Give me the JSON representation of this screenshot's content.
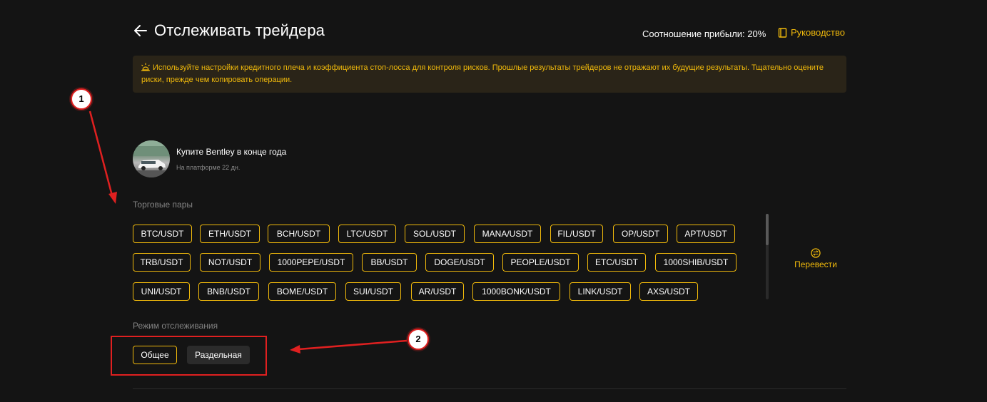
{
  "header": {
    "title": "Отслеживать трейдера",
    "profit_ratio": "Соотношение прибыли: 20%",
    "guide_label": "Руководство"
  },
  "banner": {
    "text": "Используйте настройки кредитного плеча и коэффициента стоп-лосса для контроля рисков. Прошлые результаты трейдеров не отражают их будущие результаты. Тщательно оцените риски, прежде чем копировать операции."
  },
  "trader": {
    "name": "Купите Bentley в конце года",
    "platform_days": "На платформе 22 дн."
  },
  "pairs": {
    "label": "Торговые пары",
    "items": [
      "BTC/USDT",
      "ETH/USDT",
      "BCH/USDT",
      "LTC/USDT",
      "SOL/USDT",
      "MANA/USDT",
      "FIL/USDT",
      "OP/USDT",
      "APT/USDT",
      "TRB/USDT",
      "NOT/USDT",
      "1000PEPE/USDT",
      "BB/USDT",
      "DOGE/USDT",
      "PEOPLE/USDT",
      "ETC/USDT",
      "1000SHIB/USDT",
      "UNI/USDT",
      "BNB/USDT",
      "BOME/USDT",
      "SUI/USDT",
      "AR/USDT",
      "1000BONK/USDT",
      "LINK/USDT",
      "AXS/USDT"
    ],
    "translate_label": "Перевести"
  },
  "mode": {
    "label": "Режим отслеживания",
    "options": [
      "Общее",
      "Раздельная"
    ],
    "selected": "Общее"
  },
  "annotations": {
    "marker_1": "1",
    "marker_2": "2"
  },
  "colors": {
    "background": "#141414",
    "accent": "#f0b90b",
    "banner_bg": "#2a2418",
    "annotation_red": "#e02020"
  },
  "icons": {
    "back": "arrow-left-icon",
    "guide": "book-icon",
    "banner": "alert-lamp-icon",
    "translate": "swap-icon"
  }
}
